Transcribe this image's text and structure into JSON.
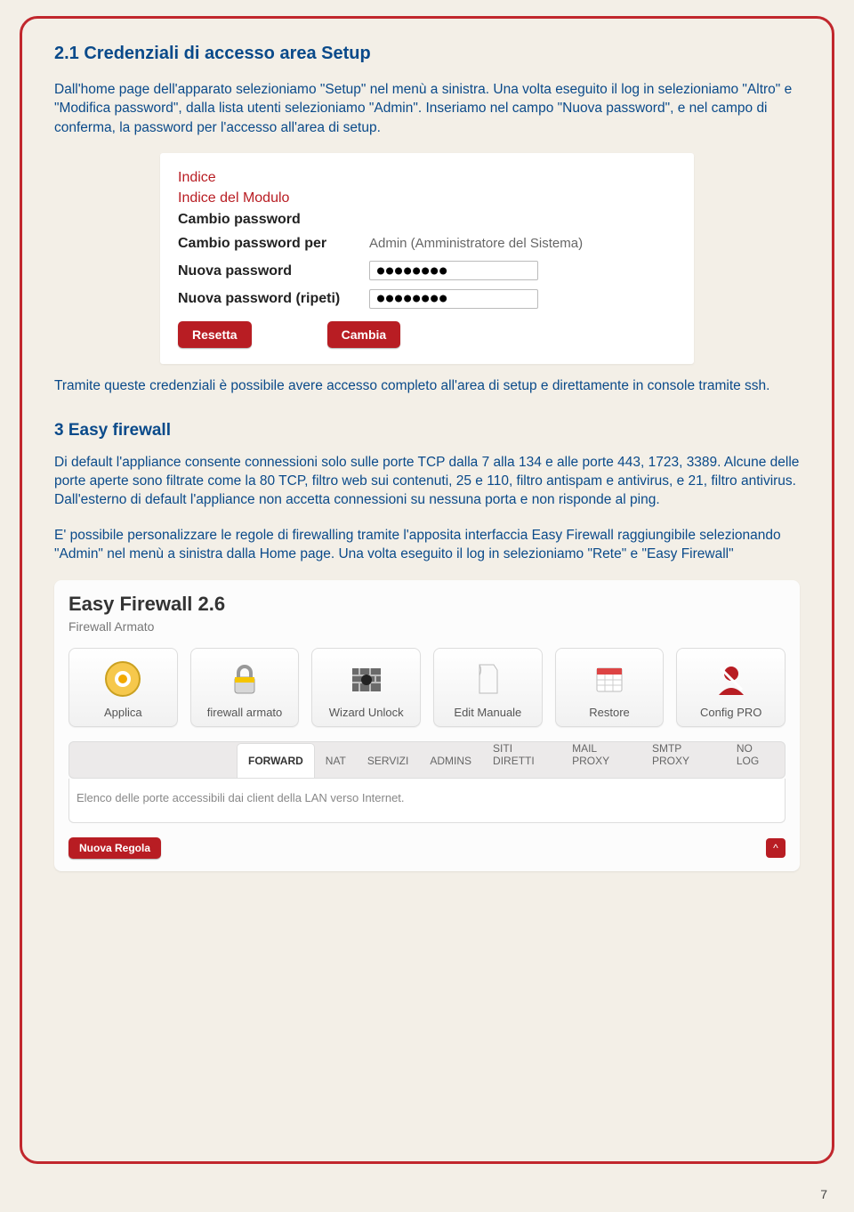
{
  "section1": {
    "heading": "2.1 Credenziali di accesso area Setup",
    "para1": "Dall'home page dell'apparato selezioniamo \"Setup\" nel menù a sinistra. Una volta eseguito il log in selezioniamo \"Altro\" e \"Modifica password\", dalla lista utenti selezioniamo \"Admin\". Inseriamo nel campo \"Nuova password\", e nel campo di conferma, la password per l'accesso all'area di setup."
  },
  "pwshot": {
    "indice": "Indice",
    "indice_modulo": "Indice del Modulo",
    "cambio_pw": "Cambio password",
    "cambio_pw_per_label": "Cambio password per",
    "cambio_pw_per_value": "Admin (Amministratore del Sistema)",
    "nuova_pw_label": "Nuova password",
    "nuova_pw_value": "●●●●●●●●",
    "nuova_pw2_label": "Nuova password (ripeti)",
    "nuova_pw2_value": "●●●●●●●●",
    "btn_reset": "Resetta",
    "btn_change": "Cambia"
  },
  "para2": "Tramite queste credenziali è possibile avere accesso completo all'area di setup e direttamente in console tramite ssh.",
  "section3": {
    "heading": "3 Easy firewall",
    "para1": "Di default l'appliance consente connessioni solo sulle porte TCP dalla 7 alla 134 e alle porte 443, 1723, 3389. Alcune delle porte aperte sono filtrate come la 80 TCP, filtro web sui contenuti, 25 e 110, filtro antispam e antivirus, e 21, filtro antivirus. Dall'esterno di default l'appliance non accetta connessioni su nessuna porta e non risponde al ping.",
    "para2": "E' possibile personalizzare le regole di firewalling tramite l'apposita interfaccia Easy Firewall raggiungibile selezionando \"Admin\" nel menù a sinistra dalla Home page. Una volta eseguito il log in selezioniamo \"Rete\" e \"Easy Firewall\""
  },
  "fw": {
    "title": "Easy Firewall 2.6",
    "subtitle": "Firewall Armato",
    "toolbar": [
      {
        "id": "applica",
        "label": "Applica"
      },
      {
        "id": "armato",
        "label": "firewall armato"
      },
      {
        "id": "wizard",
        "label": "Wizard Unlock"
      },
      {
        "id": "edit",
        "label": "Edit Manuale"
      },
      {
        "id": "restore",
        "label": "Restore"
      },
      {
        "id": "config",
        "label": "Config PRO"
      }
    ],
    "tabs": [
      "FORWARD",
      "NAT",
      "SERVIZI",
      "ADMINS",
      "SITI DIRETTI",
      "MAIL PROXY",
      "SMTP PROXY",
      "NO LOG"
    ],
    "active_tab": "FORWARD",
    "tabdesc": "Elenco delle porte accessibili dai client della LAN verso Internet.",
    "new_rule": "Nuova Regola",
    "caret": "^"
  },
  "page_number": "7"
}
